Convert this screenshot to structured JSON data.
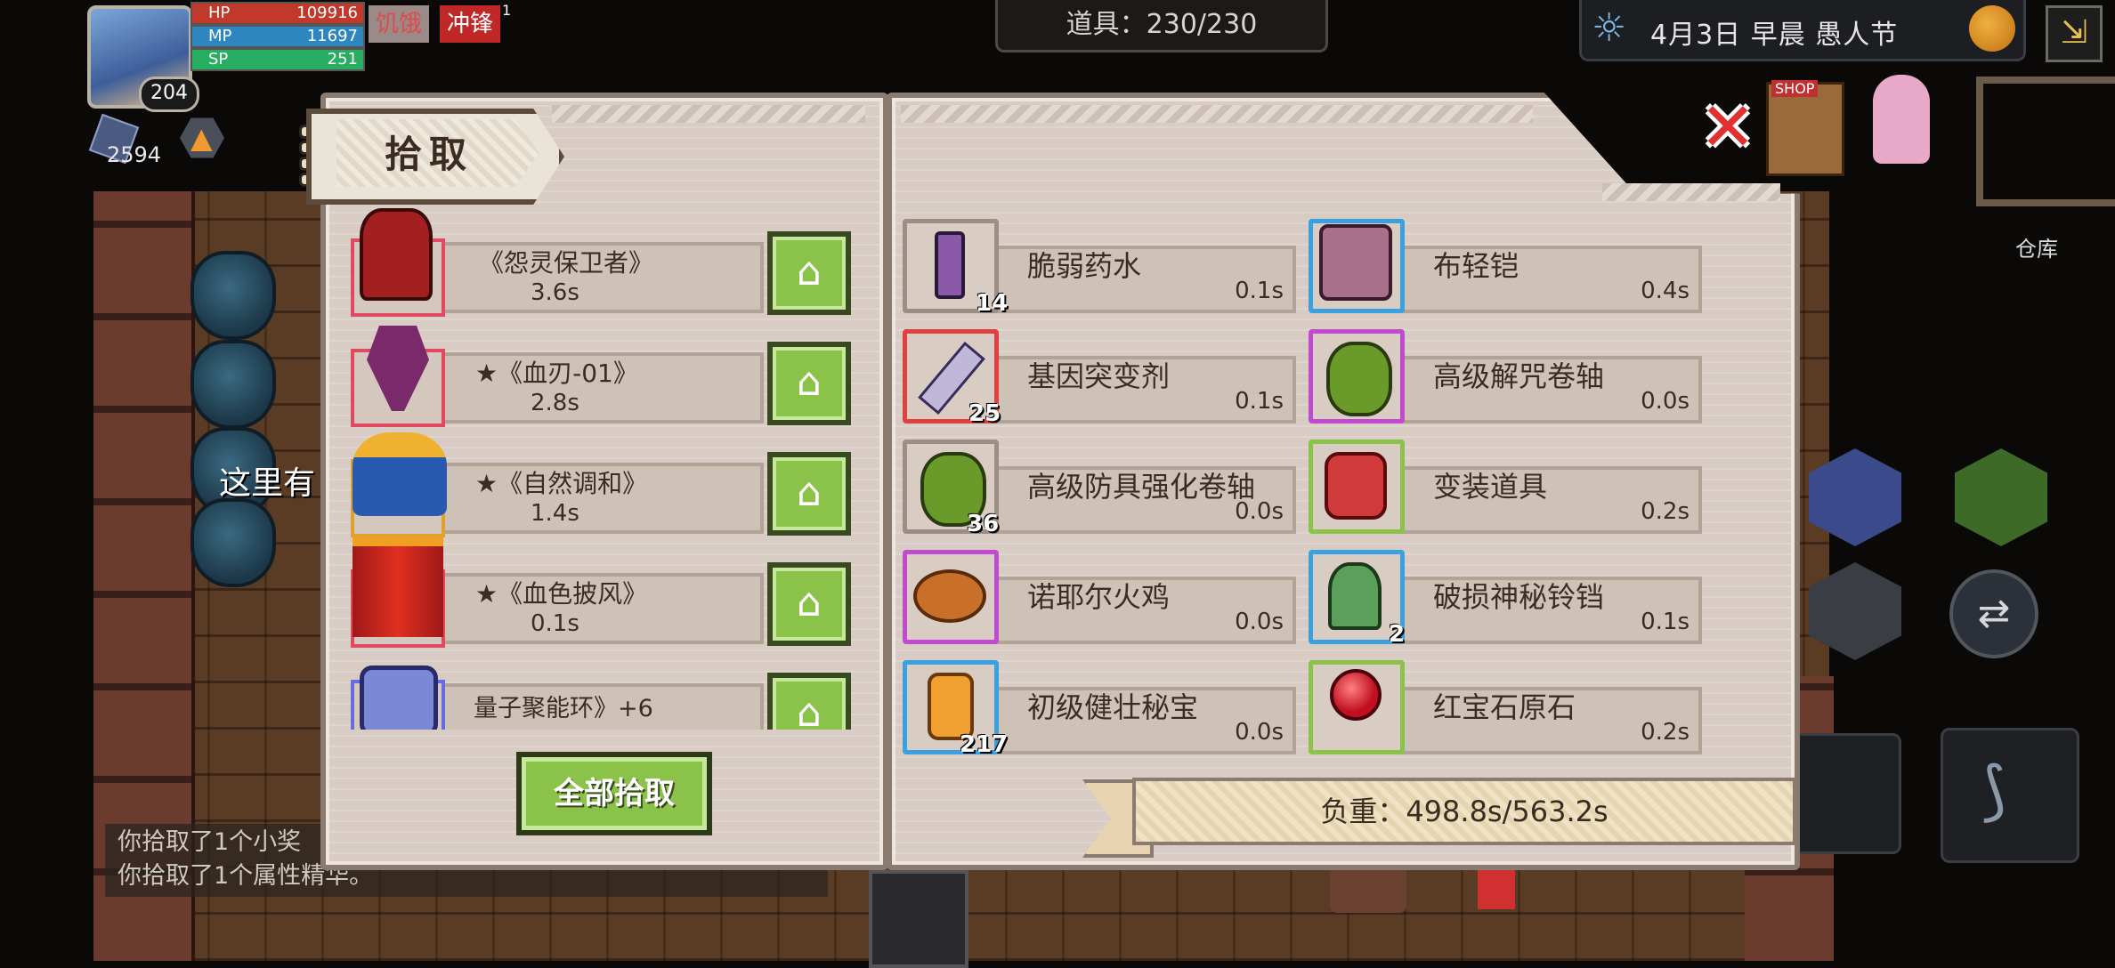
{
  "hud": {
    "hp_label": "HP",
    "hp_value": "109916",
    "mp_label": "MP",
    "mp_value": "11697",
    "sp_label": "SP",
    "sp_value": "251",
    "level": "204",
    "status_hunger": "饥饿",
    "status_charge": "冲锋",
    "status_charge_count": "1",
    "resource_count": "2594",
    "items_counter": "道具：230/230",
    "date_text": "4月3日  早晨  愚人节",
    "shop_label": "SHOP",
    "warehouse_label": "仓库",
    "npc_speech": "这里有",
    "colors": {
      "hp": "#c0392b",
      "mp": "#2e86c1",
      "sp": "#27ae60",
      "accent_green": "#8bc34a",
      "close_red": "#e03030"
    }
  },
  "chat": {
    "lines": [
      "你拾取了1个小奖",
      "你拾取了1个属性精华。"
    ]
  },
  "pickup": {
    "title": "拾取",
    "items": [
      {
        "name": "《怨灵保卫者》",
        "weight": "3.6s",
        "icon": "red-gauntlet-icon"
      },
      {
        "name": "★《血刃-01》",
        "weight": "2.8s",
        "icon": "purple-axe-icon"
      },
      {
        "name": "★《自然调和》",
        "weight": "1.4s",
        "icon": "blue-gold-helmet-icon"
      },
      {
        "name": "★《血色披风》",
        "weight": "0.1s",
        "icon": "red-cape-icon"
      },
      {
        "name": "量子聚能环》+6",
        "weight": "",
        "icon": "quantum-ring-icon"
      }
    ],
    "pickall_label": "全部拾取"
  },
  "inventory": {
    "items": [
      {
        "name": "脆弱药水",
        "weight": "0.1s",
        "count": "14",
        "icon": "potion-icon",
        "border": "b-gray"
      },
      {
        "name": "布轻铠",
        "weight": "0.4s",
        "count": "",
        "icon": "cloth-armor-icon",
        "border": "b-blue"
      },
      {
        "name": "基因突变剂",
        "weight": "0.1s",
        "count": "25",
        "icon": "syringe-icon",
        "border": "b-red"
      },
      {
        "name": "高级解咒卷轴",
        "weight": "0.0s",
        "count": "",
        "icon": "scroll-icon",
        "border": "b-purple"
      },
      {
        "name": "高级防具强化卷轴",
        "weight": "0.0s",
        "count": "36",
        "icon": "green-scroll-icon",
        "border": "b-gray"
      },
      {
        "name": "变装道具",
        "weight": "0.2s",
        "count": "",
        "icon": "disguise-icon",
        "border": "b-green"
      },
      {
        "name": "诺耶尔火鸡",
        "weight": "0.0s",
        "count": "",
        "icon": "turkey-icon",
        "border": "b-purple"
      },
      {
        "name": "破损神秘铃铛",
        "weight": "0.1s",
        "count": "2",
        "icon": "bell-icon",
        "border": "b-blue"
      },
      {
        "name": "初级健壮秘宝",
        "weight": "0.0s",
        "count": "217",
        "icon": "orange-gem-icon",
        "border": "b-blue"
      },
      {
        "name": "红宝石原石",
        "weight": "0.2s",
        "count": "",
        "icon": "ruby-icon",
        "border": "b-green"
      }
    ],
    "load_text": "负重：498.8s/563.2s"
  }
}
